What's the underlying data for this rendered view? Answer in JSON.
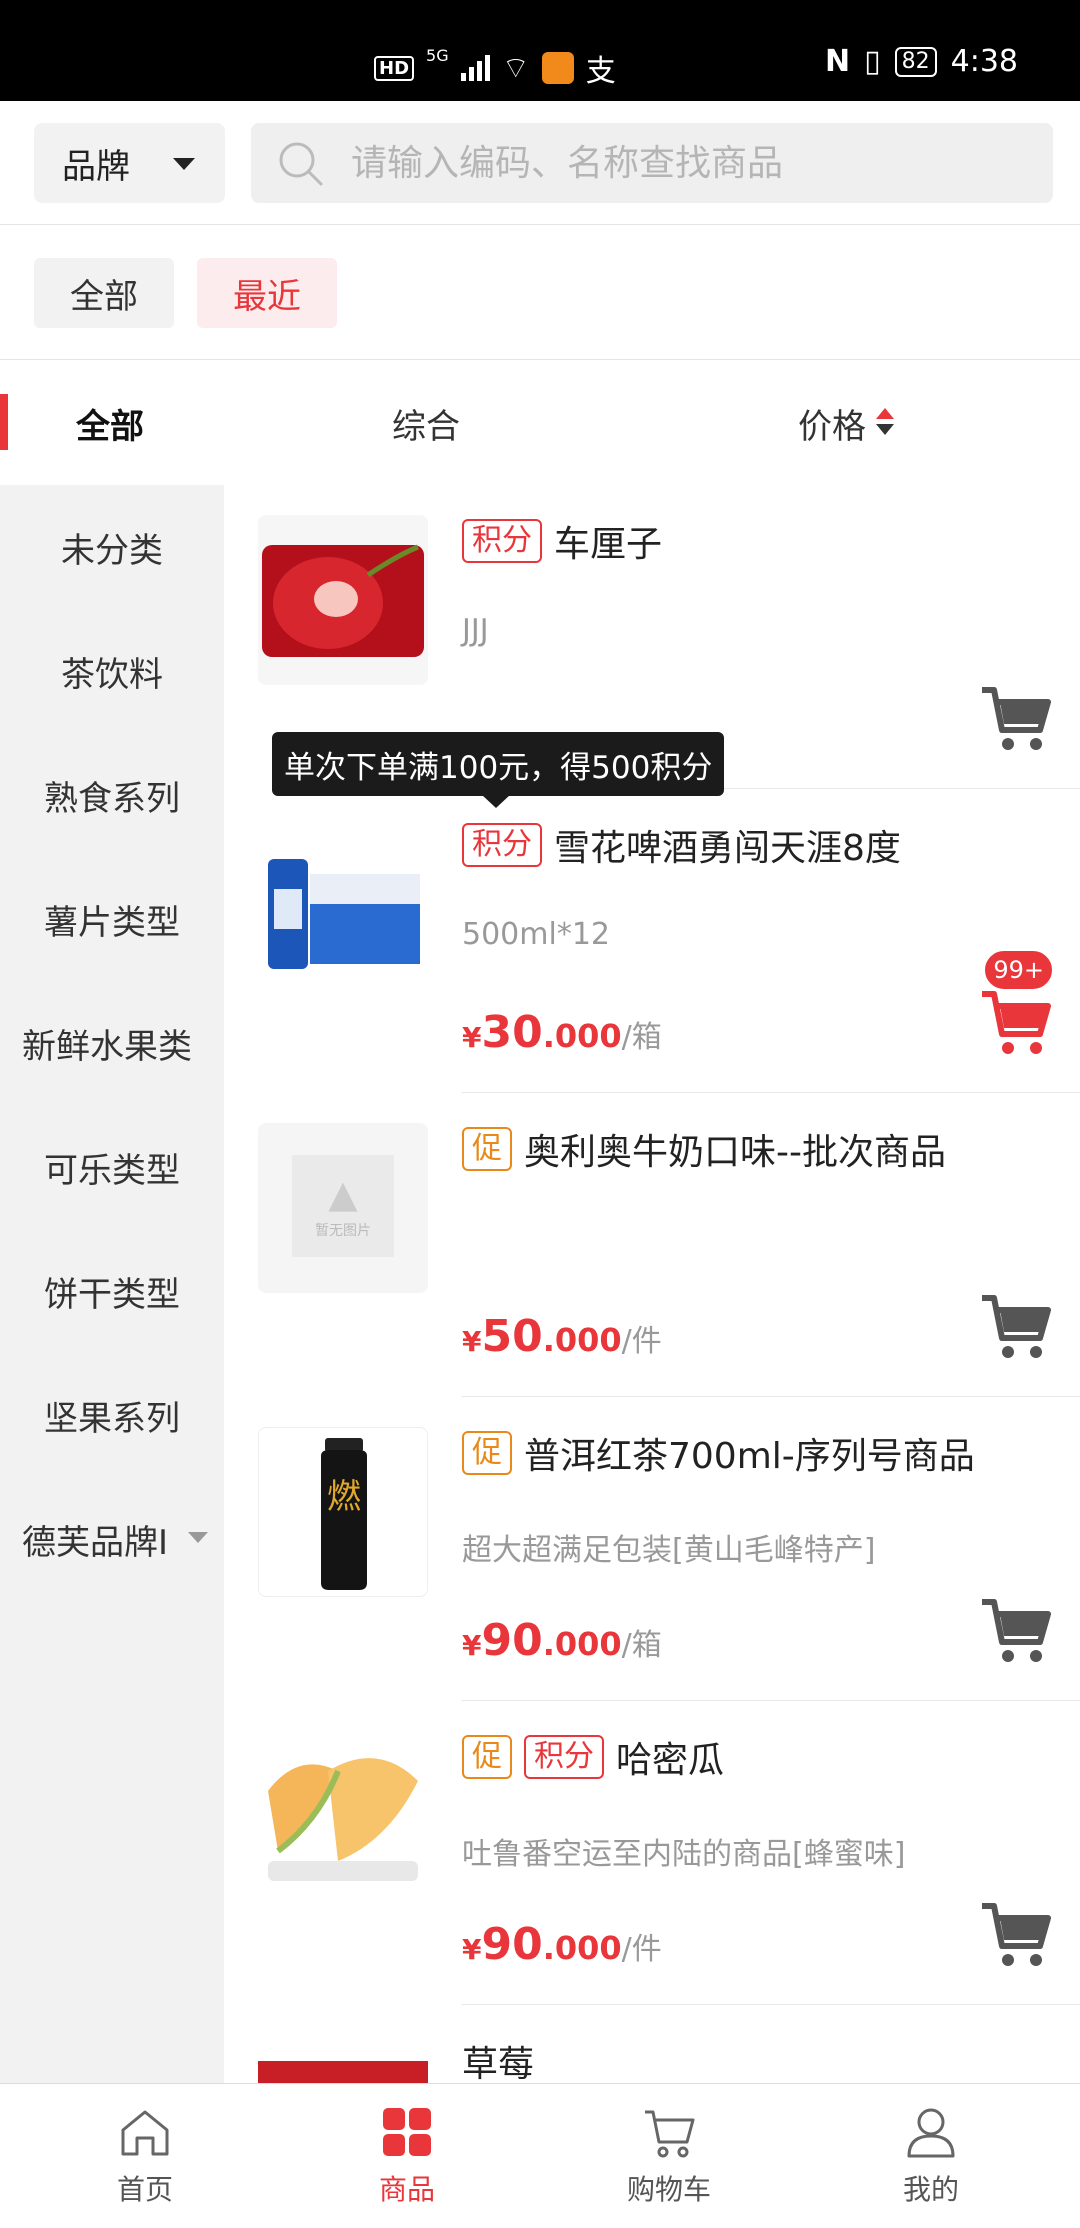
{
  "status_bar": {
    "network": "5G",
    "hd": "HD",
    "alipay": "支",
    "nfc": "N",
    "battery": "82",
    "time": "4:38"
  },
  "header": {
    "brand_label": "品牌",
    "search_placeholder": "请输入编码、名称查找商品"
  },
  "filter_chips": {
    "all": "全部",
    "recent": "最近"
  },
  "sort_tabs": {
    "all": "全部",
    "general": "综合",
    "price": "价格"
  },
  "sidebar": {
    "items": [
      "未分类",
      "茶饮料",
      "熟食系列",
      "薯片类型",
      "新鲜水果类",
      "可乐类型",
      "饼干类型",
      "坚果系列",
      "德芙品牌I"
    ]
  },
  "tooltip": {
    "text": "单次下单满100元，得500积分"
  },
  "products": [
    {
      "tags": [
        "积分"
      ],
      "name": "车厘子",
      "desc": "JJJ",
      "price_int": "",
      "price_dec": "",
      "unit": "",
      "currency": "",
      "badge": ""
    },
    {
      "tags": [
        "积分"
      ],
      "name": "雪花啤酒勇闯天涯8度",
      "desc": "500ml*12",
      "currency": "¥",
      "price_int": "30",
      "price_dec": ".000",
      "unit": "/箱",
      "badge": "99+"
    },
    {
      "tags": [
        "促"
      ],
      "name": "奥利奥牛奶口味--批次商品",
      "desc": "",
      "currency": "¥",
      "price_int": "50",
      "price_dec": ".000",
      "unit": "/件",
      "badge": "",
      "image_placeholder": "暂无图片"
    },
    {
      "tags": [
        "促"
      ],
      "name": "普洱红茶700ml-序列号商品",
      "desc": "超大超满足包装[黄山毛峰特产]",
      "currency": "¥",
      "price_int": "90",
      "price_dec": ".000",
      "unit": "/箱",
      "badge": "",
      "image_text": "燃"
    },
    {
      "tags": [
        "促",
        "积分"
      ],
      "name": "哈密瓜",
      "desc": "吐鲁番空运至内陆的商品[蜂蜜味]",
      "currency": "¥",
      "price_int": "90",
      "price_dec": ".000",
      "unit": "/件",
      "badge": ""
    },
    {
      "tags": [],
      "name": "草莓",
      "desc": "",
      "currency": "",
      "price_int": "",
      "price_dec": "",
      "unit": "",
      "badge": ""
    }
  ],
  "tabbar": {
    "home": "首页",
    "products": "商品",
    "cart": "购物车",
    "mine": "我的"
  },
  "colors": {
    "accent": "#e8363b",
    "promo": "#e8891b",
    "sidebar_bg": "#f2f2f2"
  }
}
